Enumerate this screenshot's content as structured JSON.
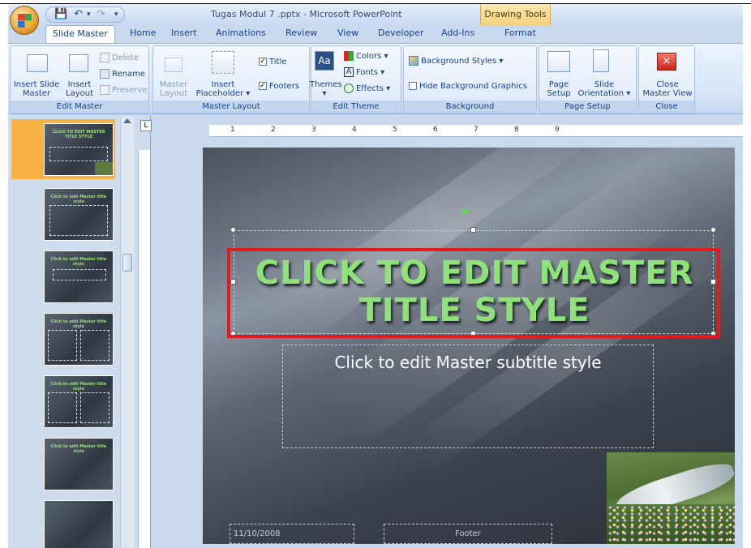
{
  "window": {
    "title": "Tugas Modul 7 .pptx - Microsoft PowerPoint",
    "context_tab_title": "Drawing Tools"
  },
  "quick_access": {
    "save": "💾",
    "undo": "↶",
    "undo_drop": "▾",
    "redo": "↷",
    "customize": "▾"
  },
  "tabs": [
    {
      "label": "Slide Master",
      "active": true
    },
    {
      "label": "Home"
    },
    {
      "label": "Insert"
    },
    {
      "label": "Animations"
    },
    {
      "label": "Review"
    },
    {
      "label": "View"
    },
    {
      "label": "Developer"
    },
    {
      "label": "Add-Ins"
    },
    {
      "label": "Format"
    }
  ],
  "ribbon": {
    "edit_master": {
      "label": "Edit Master",
      "insert_slide_master": "Insert Slide\nMaster",
      "insert_layout": "Insert\nLayout",
      "delete": "Delete",
      "rename": "Rename",
      "preserve": "Preserve"
    },
    "master_layout": {
      "label": "Master Layout",
      "master_layout": "Master\nLayout",
      "insert_placeholder": "Insert\nPlaceholder ▾",
      "title": "Title",
      "footers": "Footers"
    },
    "edit_theme": {
      "label": "Edit Theme",
      "themes": "Themes\n▾",
      "colors": "Colors ▾",
      "fonts": "Fonts ▾",
      "effects": "Effects ▾"
    },
    "background": {
      "label": "Background",
      "background_styles": "Background Styles ▾",
      "hide_background_graphics": "Hide Background Graphics"
    },
    "page_setup": {
      "label": "Page Setup",
      "page_setup": "Page\nSetup",
      "slide_orientation": "Slide\nOrientation ▾"
    },
    "close": {
      "label": "Close",
      "close_master_view": "Close\nMaster View"
    }
  },
  "ruler": {
    "marks": [
      "1",
      "2",
      "3",
      "4",
      "5",
      "6",
      "7",
      "8",
      "9"
    ],
    "corner": "L"
  },
  "thumbnails": [
    {
      "title": "CLICK TO EDIT MASTER TITLE STYLE"
    },
    {
      "title": "Click to edit Master title style"
    },
    {
      "title": "Click to edit Master title style"
    },
    {
      "title": "Click to edit Master title style"
    },
    {
      "title": "Click to edit Master title style"
    },
    {
      "title": "Click to edit Master title style"
    },
    {
      "title": ""
    }
  ],
  "slide": {
    "title": "CLICK TO EDIT MASTER TITLE STYLE",
    "subtitle": "Click to edit Master subtitle style",
    "date": "11/10/2008",
    "footer": "Footer"
  }
}
